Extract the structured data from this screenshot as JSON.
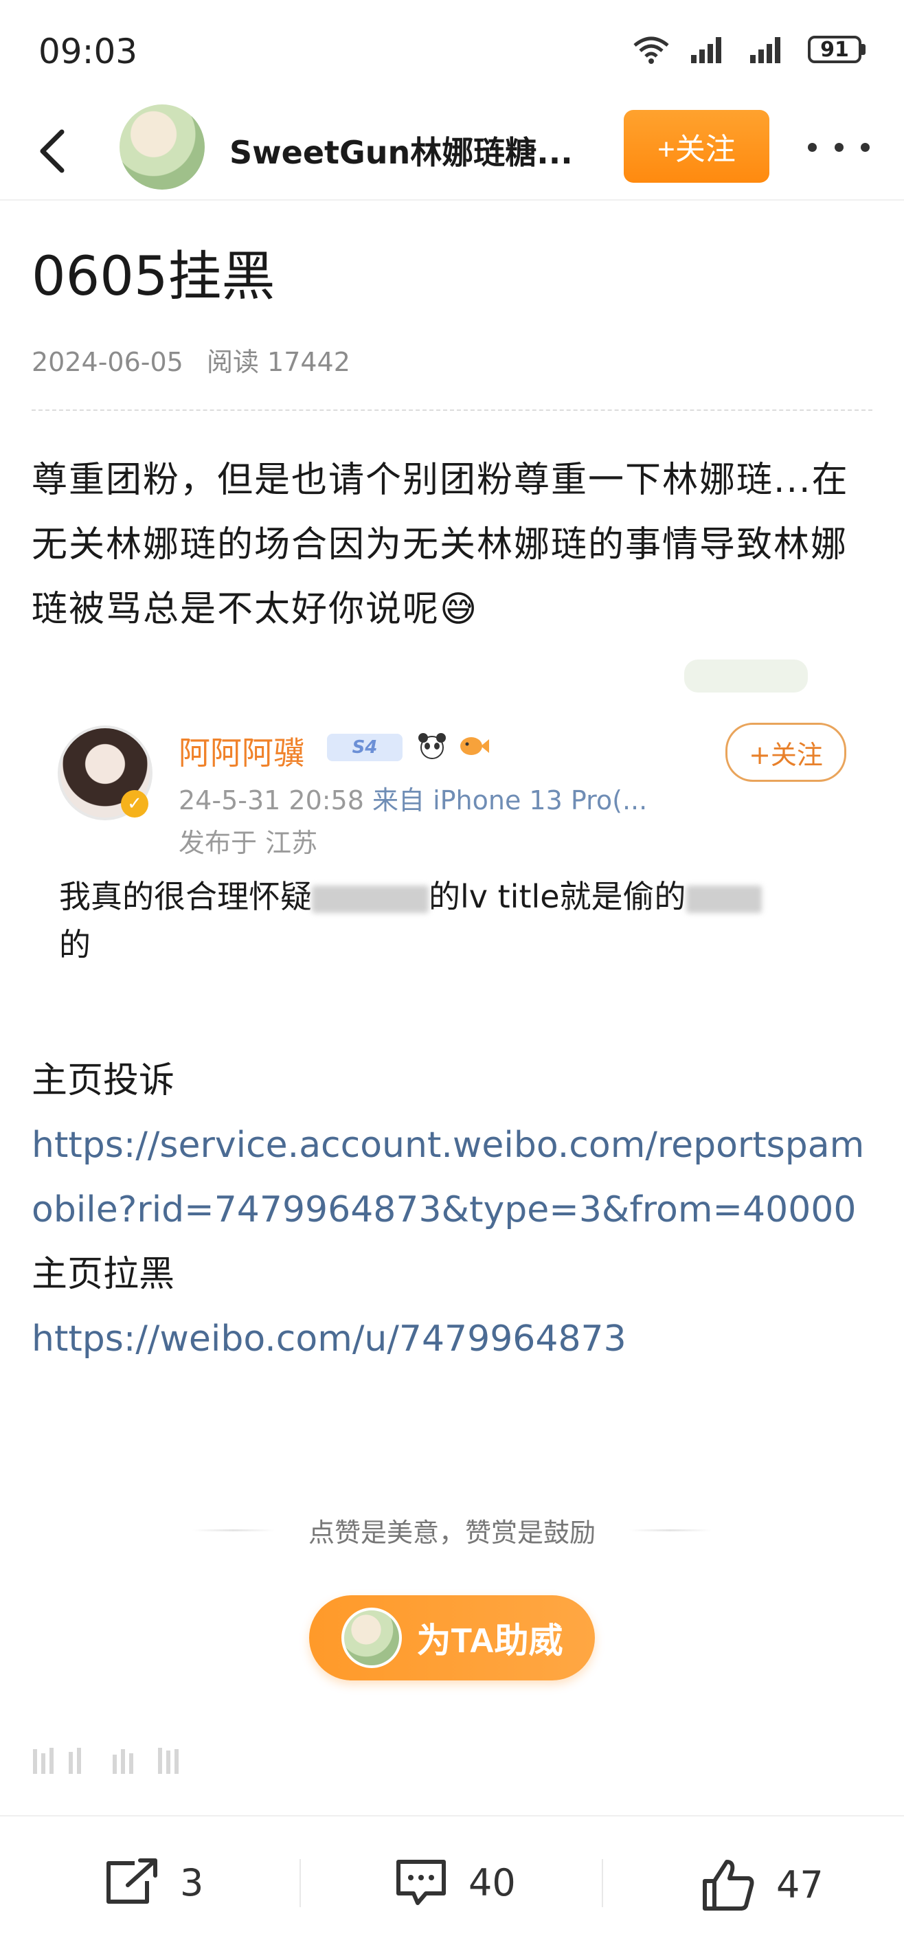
{
  "status_bar": {
    "time": "09:03",
    "battery": "91"
  },
  "nav": {
    "title": "SweetGun林娜琏糖...",
    "follow_label": "+关注"
  },
  "article": {
    "title": "0605挂黑",
    "date": "2024-06-05",
    "reads_label": "阅读 17442",
    "body": "尊重团粉，但是也请个别团粉尊重一下林娜琏...在无关林娜琏的场合因为无关林娜琏的事情导致林娜琏被骂总是不太好你说呢😅"
  },
  "quoted_post": {
    "username": "阿阿阿骥",
    "level_badge": "S4",
    "follow_label": "+关注",
    "time": "24-5-31 20:58",
    "source": "来自 iPhone 13 Pro(...",
    "location": "发布于 江苏",
    "text_part1": "我真的很合理怀疑",
    "text_part2": "的lv title就是偷的",
    "text_part3": "的"
  },
  "links": {
    "report_label": "主页投诉",
    "report_url": "https://service.account.weibo.com/reportspamobile?rid=7479964873&type=3&from=40000",
    "block_label": "主页拉黑",
    "block_url": "https://weibo.com/u/7479964873"
  },
  "reward": {
    "tagline": "点赞是美意，赞赏是鼓励",
    "button_label": "为TA助威"
  },
  "bottom_bar": {
    "share_count": "3",
    "comment_count": "40",
    "like_count": "47"
  }
}
